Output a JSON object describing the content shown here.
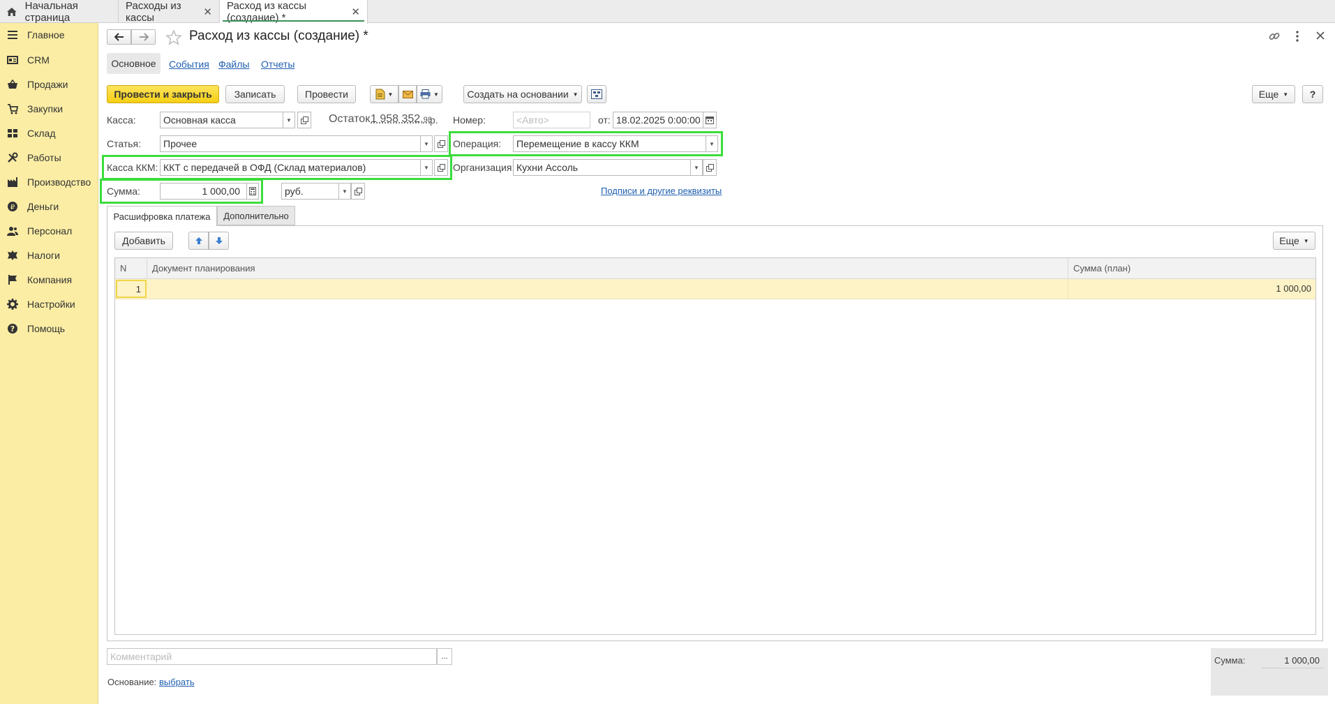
{
  "tabs": [
    {
      "label": "Начальная страница",
      "closable": false
    },
    {
      "label": "Расходы из кассы",
      "closable": true
    },
    {
      "label": "Расход из кассы (создание) *",
      "closable": true
    }
  ],
  "sidebar": {
    "items": [
      {
        "label": "Главное",
        "icon": "menu-icon"
      },
      {
        "label": "CRM",
        "icon": "crm-card-icon"
      },
      {
        "label": "Продажи",
        "icon": "sales-basket-icon"
      },
      {
        "label": "Закупки",
        "icon": "purchases-cart-icon"
      },
      {
        "label": "Склад",
        "icon": "warehouse-grid-icon"
      },
      {
        "label": "Работы",
        "icon": "tools-icon"
      },
      {
        "label": "Производство",
        "icon": "factory-icon"
      },
      {
        "label": "Деньги",
        "icon": "money-coin-icon"
      },
      {
        "label": "Персонал",
        "icon": "people-icon"
      },
      {
        "label": "Налоги",
        "icon": "emblem-icon"
      },
      {
        "label": "Компания",
        "icon": "flag-icon"
      },
      {
        "label": "Настройки",
        "icon": "gear-icon"
      },
      {
        "label": "Помощь",
        "icon": "help-icon"
      }
    ]
  },
  "header": {
    "title": "Расход из кассы (создание) *"
  },
  "section_tabs": {
    "main": "Основное",
    "events": "События",
    "files": "Файлы",
    "reports": "Отчеты"
  },
  "toolbar": {
    "post_close": "Провести и закрыть",
    "save": "Записать",
    "post": "Провести",
    "create_based": "Создать на основании",
    "more": "Еще",
    "help": "?"
  },
  "form": {
    "kassa_label": "Касса:",
    "kassa_value": "Основная касса",
    "ostatok_label": "Остаток",
    "ostatok_int": "1 958 352,",
    "ostatok_dec": "98",
    "ostatok_cur": "р.",
    "nomer_label": "Номер:",
    "nomer_placeholder": "<Авто>",
    "ot_label": "от:",
    "date_value": "18.02.2025  0:00:00",
    "statya_label": "Статья:",
    "statya_value": "Прочее",
    "operacia_label": "Операция:",
    "operacia_value": "Перемещение в кассу ККМ",
    "kkm_label": "Касса ККМ:",
    "kkm_value": "ККТ с передачей в ОФД (Склад материалов)",
    "org_label": "Организация:",
    "org_value": "Кухни Ассоль",
    "summa_label": "Сумма:",
    "summa_value": "1 000,00",
    "currency_value": "руб.",
    "signatures_link": "Подписи и другие реквизиты"
  },
  "inner_tabs": {
    "payment": "Расшифровка платежа",
    "additional": "Дополнительно"
  },
  "table_toolbar": {
    "add": "Добавить",
    "more": "Еще"
  },
  "table": {
    "columns": [
      "N",
      "Документ планирования",
      "Сумма (план)"
    ],
    "rows": [
      {
        "n": "1",
        "doc": "",
        "sum": "1 000,00"
      }
    ]
  },
  "footer": {
    "comment_placeholder": "Комментарий",
    "comment_btn": "...",
    "osnovanie_label": "Основание:",
    "osnovanie_link": "выбрать",
    "total_label": "Сумма:",
    "total_value": "1 000,00"
  },
  "colors": {
    "sidebar_bg": "#fbeda4",
    "primary_btn": "#f5cf14",
    "highlight": "#3cdc3c",
    "link": "#1f5fb0",
    "selected_row": "#fdf3c7"
  }
}
